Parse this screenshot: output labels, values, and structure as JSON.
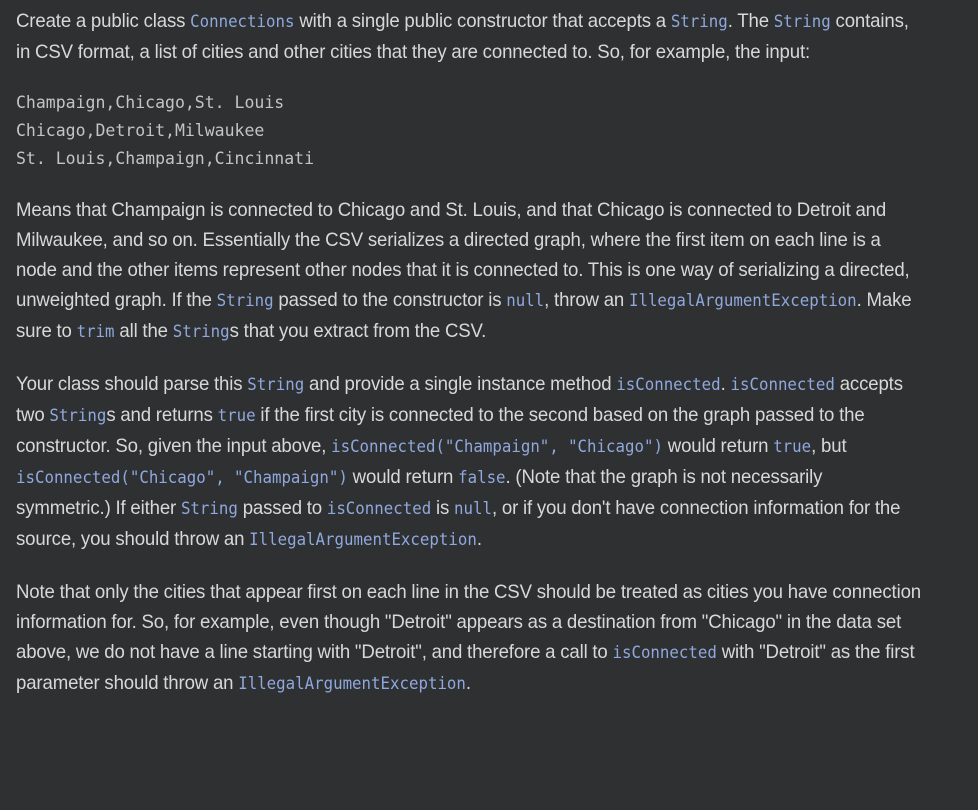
{
  "theme": {
    "background": "#2f3031",
    "body_text": "#d7d8d8",
    "code_text": "#8fa8dd",
    "code_block_text": "#c3c4c4"
  },
  "document": {
    "paragraph1": {
      "seg1": "Create a public class ",
      "code1": "Connections",
      "seg2": " with a single public constructor that accepts a ",
      "code2": "String",
      "seg3": ". The ",
      "code3": "String",
      "seg4": " contains, in CSV format, a list of cities and other cities that they are connected to. So, for example, the input:"
    },
    "code_block": "Champaign,Chicago,St. Louis\nChicago,Detroit,Milwaukee\nSt. Louis,Champaign,Cincinnati",
    "paragraph2": {
      "seg1": "Means that Champaign is connected to Chicago and St. Louis, and that Chicago is connected to Detroit and Milwaukee, and so on. Essentially the CSV serializes a directed graph, where the first item on each line is a node and the other items represent other nodes that it is connected to. This is one way of serializing a directed, unweighted graph. If the ",
      "code1": "String",
      "seg2": " passed to the constructor is ",
      "code2": "null",
      "seg3": ", throw an ",
      "code3": "IllegalArgumentException",
      "seg4": ". Make sure to ",
      "code4": "trim",
      "seg5": " all the ",
      "code5": "String",
      "seg6": "s that you extract from the CSV."
    },
    "paragraph3": {
      "seg1": "Your class should parse this ",
      "code1": "String",
      "seg2": " and provide a single instance method ",
      "code2": "isConnected",
      "seg3": ". ",
      "code3": "isConnected",
      "seg4": " accepts two ",
      "code4": "String",
      "seg5": "s and returns ",
      "code5": "true",
      "seg6": " if the first city is connected to the second based on the graph passed to the constructor. So, given the input above, ",
      "code6": "isConnected(\"Champaign\", \"Chicago\")",
      "seg7": " would return ",
      "code7": "true",
      "seg8": ", but ",
      "code8": "isConnected(\"Chicago\", \"Champaign\")",
      "seg9": " would return ",
      "code9": "false",
      "seg10": ". (Note that the graph is not necessarily symmetric.) If either ",
      "code10": "String",
      "seg11": " passed to ",
      "code11": "isConnected",
      "seg12": " is ",
      "code12": "null",
      "seg13": ", or if you don't have connection information for the source, you should throw an ",
      "code13": "IllegalArgumentException",
      "seg14": "."
    },
    "paragraph4": {
      "seg1": "Note that only the cities that appear first on each line in the CSV should be treated as cities you have connection information for. So, for example, even though \"Detroit\" appears as a destination from \"Chicago\" in the data set above, we do not have a line starting with \"Detroit\", and therefore a call to ",
      "code1": "isConnected",
      "seg2": " with \"Detroit\" as the first parameter should throw an ",
      "code2": "IllegalArgumentException",
      "seg3": "."
    }
  }
}
